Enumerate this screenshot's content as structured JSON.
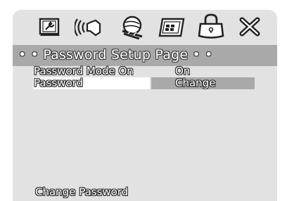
{
  "toolbar": {
    "icons": [
      "general-setup-icon",
      "audio-setup-icon",
      "video-setup-icon",
      "preference-icon",
      "password-lock-icon",
      "exit-icon"
    ]
  },
  "header": {
    "title": "• • Password Setup Page • •"
  },
  "settings": [
    {
      "label": "Password Mode On",
      "value": "On"
    },
    {
      "label": "Password",
      "value": "Change",
      "selected": true
    }
  ],
  "footer": {
    "hint": "Change Password"
  },
  "colors": {
    "panel": "#e2e2e2",
    "titlebar": "#a9a9a9",
    "highlight": "#a9a9a9",
    "selected_label_bg": "#ffffff"
  }
}
